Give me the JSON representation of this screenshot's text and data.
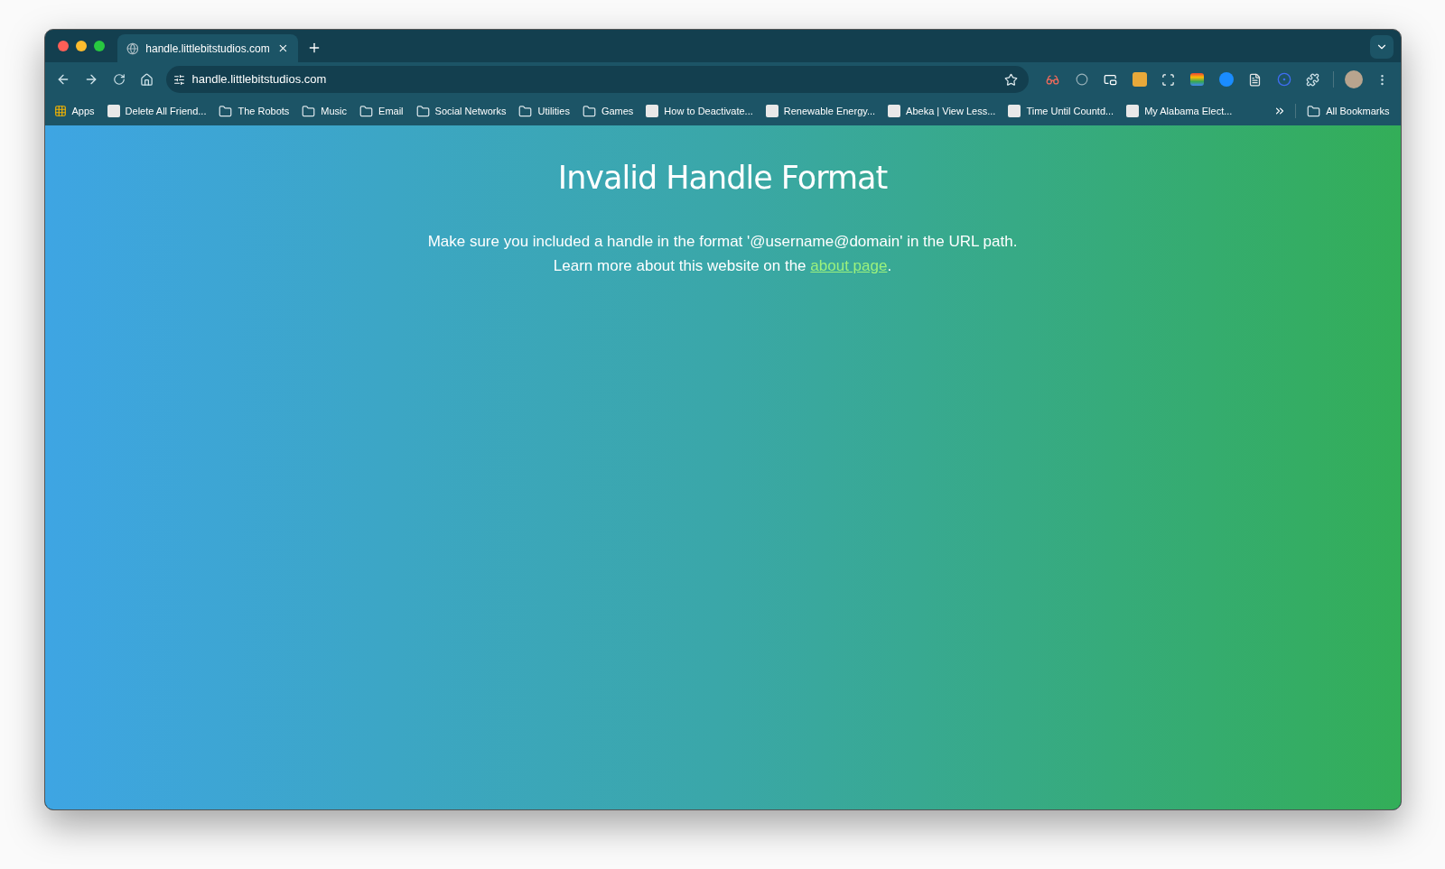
{
  "tabs": [
    {
      "title": "handle.littlebitstudios.com",
      "selected": true
    }
  ],
  "address_bar": {
    "value": "handle.littlebitstudios.com"
  },
  "bookmarks": [
    {
      "kind": "apps",
      "label": "Apps"
    },
    {
      "kind": "site",
      "label": "Delete All Friend..."
    },
    {
      "kind": "folder",
      "label": "The Robots"
    },
    {
      "kind": "folder",
      "label": "Music"
    },
    {
      "kind": "folder",
      "label": "Email"
    },
    {
      "kind": "folder",
      "label": "Social Networks"
    },
    {
      "kind": "folder",
      "label": "Utilities"
    },
    {
      "kind": "folder",
      "label": "Games"
    },
    {
      "kind": "site",
      "label": "How to Deactivate..."
    },
    {
      "kind": "site",
      "label": "Renewable Energy..."
    },
    {
      "kind": "site",
      "label": "Abeka | View Less..."
    },
    {
      "kind": "site",
      "label": "Time Until Countd..."
    },
    {
      "kind": "site",
      "label": "My Alabama Elect..."
    }
  ],
  "all_bookmarks": {
    "label": "All Bookmarks"
  },
  "page": {
    "title": "Invalid Handle Format",
    "line_1": "Make sure you included a handle in the format '@username@domain' in the URL path.",
    "line_2_before": "Learn more about this website on the",
    "link": "about page",
    "line_2_after": "."
  }
}
